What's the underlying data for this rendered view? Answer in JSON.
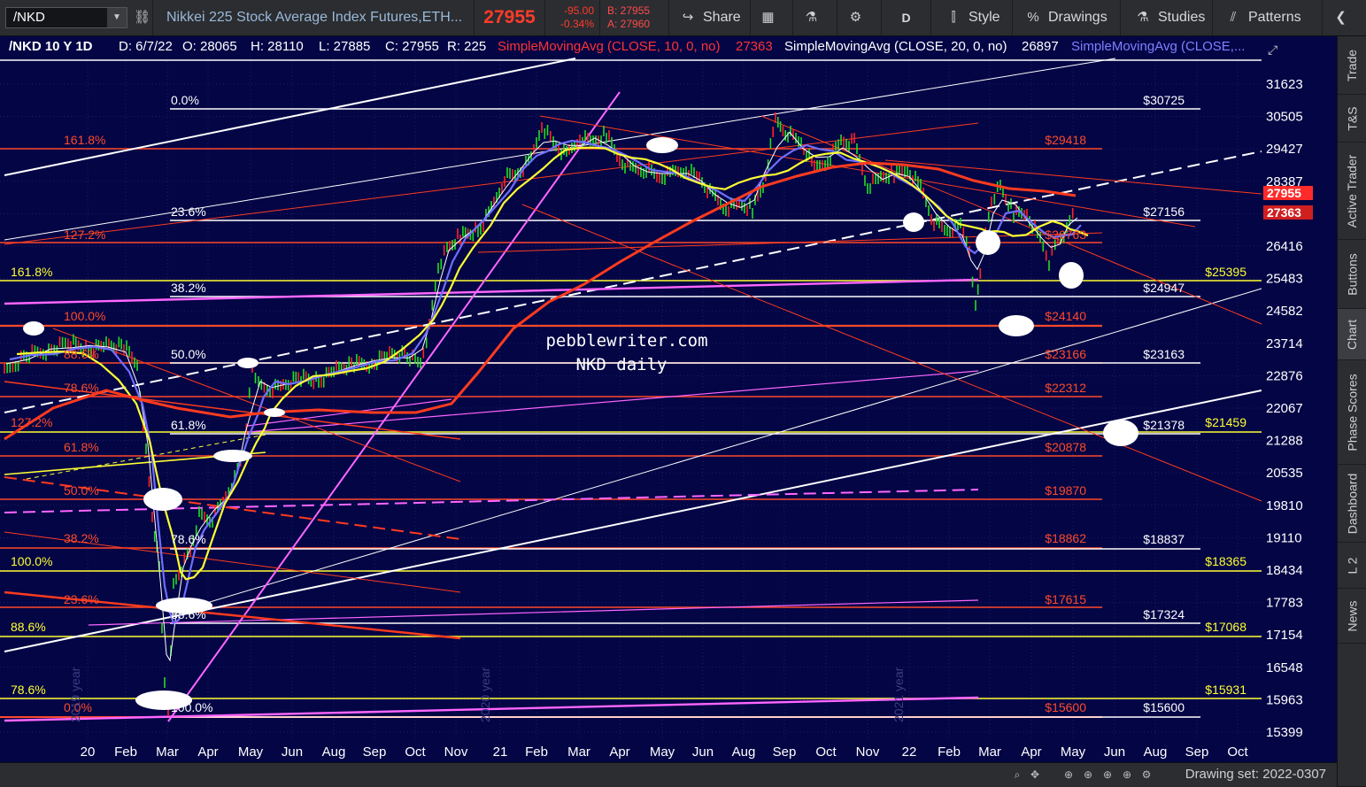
{
  "toolbar": {
    "symbol": "/NKD",
    "description": "Nikkei 225 Stock Average Index Futures,ETH...",
    "last": "27955",
    "change": "-95.00",
    "change_pct": "-0.34%",
    "bid": "B: 27955",
    "ask": "A: 27960",
    "share": "Share",
    "period": "D",
    "style": "Style",
    "drawings": "Drawings",
    "studies": "Studies",
    "patterns": "Patterns"
  },
  "header": {
    "title": "/NKD 10 Y 1D",
    "date": "D: 6/7/22",
    "open": "O: 28065",
    "high": "H: 28110",
    "low": "L: 27885",
    "close": "C: 27955",
    "range": "R: 225",
    "sma1_label": "SimpleMovingAvg (CLOSE, 10, 0, no)",
    "sma1_value": "27363",
    "sma2_label": "SimpleMovingAvg (CLOSE, 20, 0, no)",
    "sma2_value": "26897",
    "sma3_label": "SimpleMovingAvg (CLOSE,..."
  },
  "colors": {
    "background": "#030545",
    "red": "#ff3b1e",
    "yellow": "#ffff33",
    "white": "#ffffff",
    "magenta": "#ff66ff",
    "blue": "#7777ff",
    "orange_label": "#ff4a2a",
    "toolbar": "#2b2d31"
  },
  "chart_data": {
    "type": "line",
    "watermark_line1": "pebblewriter.com",
    "watermark_line2": "NKD daily",
    "price_axis": [
      "31623",
      "30505",
      "29427",
      "28387",
      "27384",
      "26416",
      "25483",
      "24582",
      "23714",
      "22876",
      "22067",
      "21288",
      "20535",
      "19810",
      "19110",
      "18434",
      "17783",
      "17154",
      "16548",
      "15963",
      "15399"
    ],
    "time_axis": [
      "20",
      "Feb",
      "Mar",
      "Apr",
      "May",
      "Jun",
      "Aug",
      "Sep",
      "Oct",
      "Nov",
      "21",
      "Feb",
      "Mar",
      "Apr",
      "May",
      "Jun",
      "Aug",
      "Sep",
      "Oct",
      "Nov",
      "22",
      "Feb",
      "Mar",
      "Apr",
      "May",
      "Jun",
      "Aug",
      "Sep",
      "Oct"
    ],
    "year_marks": [
      "2019 year",
      "2020 year",
      "2021 year"
    ],
    "last_price_box": "27955",
    "sma_price_box": "27363",
    "fib_left_yellow": [
      "161.8%",
      "100.0%",
      "88.6%",
      "78.6%"
    ],
    "fib_left_red": [
      "161.8%",
      "127.2%",
      "100.0%",
      "88.6%",
      "78.6%",
      "127.2%",
      "61.8%",
      "50.0%",
      "38.2%",
      "23.6%",
      "0.0%"
    ],
    "fib_white": [
      "0.0%",
      "23.6%",
      "38.2%",
      "50.0%",
      "61.8%",
      "78.6%",
      "88.6%",
      "100.0%"
    ],
    "level_labels_red": [
      "$29418",
      "$24140",
      "$23166",
      "$22312",
      "$20878",
      "$19870",
      "$18862",
      "$17615",
      "$15600"
    ],
    "level_labels_white": [
      "$30725",
      "$27156",
      "$24947",
      "$23163",
      "$21378",
      "$18837",
      "$17324",
      "$15600"
    ],
    "level_labels_yellow": [
      "$25395",
      "$21459",
      "$18365",
      "$17068",
      "$15931"
    ],
    "partial_label": "$26763"
  },
  "sidebar": {
    "tabs": [
      "Trade",
      "T&S",
      "Active Trader",
      "Buttons",
      "Chart",
      "Phase Scores",
      "Dashboard",
      "L 2",
      "News"
    ]
  },
  "bottombar": {
    "drawing_set": "Drawing set: 2022-0307"
  }
}
